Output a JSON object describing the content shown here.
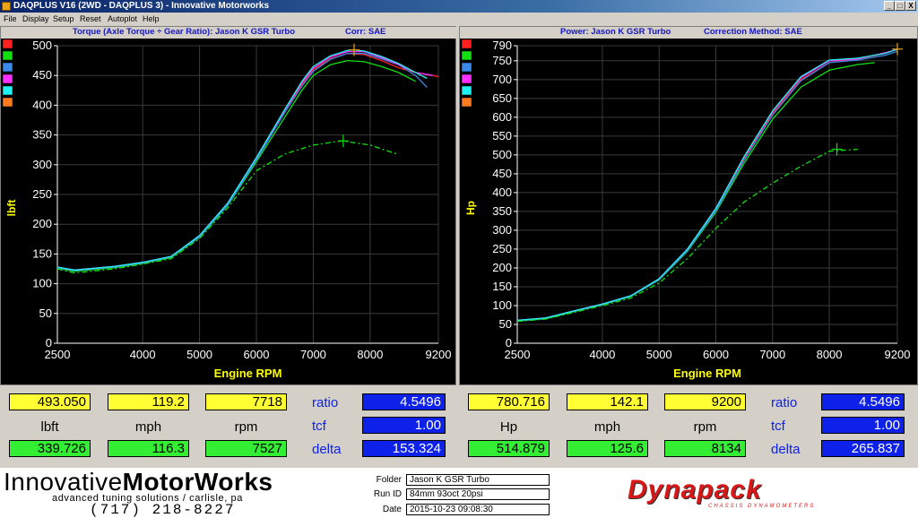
{
  "window": {
    "title": "DAQPLUS V16 (2WD - DAQPLUS 3) - Innovative Motorworks",
    "min": "_",
    "max": "□",
    "close": "X"
  },
  "menu": [
    "File",
    "Display",
    "Setup",
    "Reset",
    "Autoplot",
    "Help"
  ],
  "colors": {
    "series": [
      "#ff2020",
      "#10e010",
      "#3a88e8",
      "#ff30ff",
      "#20f0f0",
      "#ff7a20"
    ],
    "axis_text": "#ffffff",
    "axis_label": "#ffff00",
    "grid": "#3a3a3a"
  },
  "torque_panel": {
    "header_title": "Torque (Axle Torque ÷ Gear Ratio): Jason K GSR Turbo",
    "header_corr": "Corr: SAE",
    "ylabel": "lbft",
    "xlabel": "Engine RPM",
    "readout": {
      "peak_value": "493.050",
      "peak_mph": "119.2",
      "peak_rpm": "7718",
      "unit": "lbft",
      "mph_label": "mph",
      "rpm_label": "rpm",
      "base_value": "339.726",
      "base_mph": "116.3",
      "base_rpm": "7527",
      "ratio_label": "ratio",
      "ratio": "4.5496",
      "tcf_label": "tcf",
      "tcf": "1.00",
      "delta_label": "delta",
      "delta": "153.324"
    }
  },
  "power_panel": {
    "header_title": "Power: Jason K GSR Turbo",
    "header_corr": "Correction Method: SAE",
    "ylabel": "Hp",
    "xlabel": "Engine RPM",
    "readout": {
      "peak_value": "780.716",
      "peak_mph": "142.1",
      "peak_rpm": "9200",
      "unit": "Hp",
      "mph_label": "mph",
      "rpm_label": "rpm",
      "base_value": "514.879",
      "base_mph": "125.6",
      "base_rpm": "8134",
      "ratio_label": "ratio",
      "ratio": "4.5496",
      "tcf_label": "tcf",
      "tcf": "1.00",
      "delta_label": "delta",
      "delta": "265.837"
    }
  },
  "footer": {
    "logo_light": "Innovative",
    "logo_bold": "MotorWorks",
    "tagline": "advanced tuning solutions / carlisle, pa",
    "phone": "(717)  218-8227",
    "folder_label": "Folder",
    "folder": "Jason K GSR Turbo",
    "runid_label": "Run ID",
    "runid": "84mm 93oct 20psi",
    "date_label": "Date",
    "date": "2015-10-23 09:08:30",
    "brand": "Dynapack",
    "brand_sub": "CHASSIS DYNAMOMETERS"
  },
  "chart_data": [
    {
      "type": "line",
      "title": "Torque (Axle Torque ÷ Gear Ratio): Jason K GSR Turbo",
      "xlabel": "Engine RPM",
      "ylabel": "lbft",
      "xlim": [
        2500,
        9200
      ],
      "ylim": [
        0,
        500
      ],
      "xticks": [
        2500,
        4000,
        5000,
        6000,
        7000,
        8000,
        9200
      ],
      "yticks": [
        0,
        50,
        100,
        150,
        200,
        250,
        300,
        350,
        400,
        450,
        500
      ],
      "grid": true,
      "legend": "left",
      "series": [
        {
          "color": "#ff2020",
          "style": "solid",
          "x": [
            2500,
            2800,
            3500,
            4000,
            4500,
            5000,
            5500,
            6000,
            6500,
            6800,
            7000,
            7300,
            7600,
            7900,
            8200,
            8500,
            8800,
            9100,
            9200
          ],
          "y": [
            128,
            122,
            128,
            135,
            145,
            180,
            235,
            310,
            390,
            435,
            460,
            478,
            487,
            485,
            475,
            463,
            455,
            450,
            448
          ]
        },
        {
          "color": "#10e010",
          "style": "solid",
          "x": [
            2500,
            2800,
            3500,
            4000,
            4500,
            5000,
            5500,
            6000,
            6500,
            6800,
            7000,
            7300,
            7600,
            7900,
            8200,
            8500,
            8800
          ],
          "y": [
            126,
            121,
            127,
            134,
            144,
            178,
            232,
            305,
            380,
            425,
            450,
            468,
            475,
            473,
            465,
            455,
            440
          ]
        },
        {
          "color": "#3a88e8",
          "style": "solid",
          "x": [
            2500,
            2800,
            3500,
            4000,
            4500,
            5000,
            5500,
            6000,
            6500,
            6800,
            7000,
            7300,
            7600,
            7900,
            8200,
            8500,
            8800,
            9000
          ],
          "y": [
            127,
            122,
            128,
            135,
            145,
            179,
            233,
            308,
            388,
            432,
            457,
            477,
            487,
            487,
            478,
            468,
            450,
            430
          ]
        },
        {
          "color": "#ff30ff",
          "style": "solid",
          "x": [
            2500,
            2800,
            3500,
            4000,
            4500,
            5000,
            5500,
            6000,
            6500,
            6800,
            7000,
            7300,
            7600,
            7900,
            8200,
            8500,
            8800,
            9100
          ],
          "y": [
            128,
            123,
            129,
            136,
            146,
            181,
            236,
            312,
            392,
            438,
            462,
            481,
            490,
            490,
            480,
            468,
            455,
            450
          ]
        },
        {
          "color": "#20f0f0",
          "style": "solid",
          "x": [
            2500,
            2800,
            3500,
            4000,
            4500,
            5000,
            5500,
            6000,
            6500,
            6800,
            7000,
            7300,
            7600,
            7700,
            7900,
            8200,
            8500,
            8800,
            9000
          ],
          "y": [
            128,
            123,
            129,
            136,
            146,
            181,
            236,
            312,
            393,
            440,
            465,
            483,
            492,
            493,
            491,
            482,
            470,
            455,
            445
          ]
        },
        {
          "color": "#10e010",
          "style": "dashed",
          "x": [
            2500,
            2800,
            3500,
            4000,
            4500,
            5000,
            5500,
            6000,
            6500,
            7000,
            7500,
            8000,
            8500
          ],
          "y": [
            125,
            118,
            125,
            133,
            142,
            176,
            228,
            290,
            318,
            333,
            340,
            333,
            317
          ]
        }
      ],
      "markers": [
        {
          "x": 7718,
          "y": 493
        },
        {
          "x": 7527,
          "y": 340
        }
      ]
    },
    {
      "type": "line",
      "title": "Power: Jason K GSR Turbo",
      "xlabel": "Engine RPM",
      "ylabel": "Hp",
      "xlim": [
        2500,
        9200
      ],
      "ylim": [
        0,
        790
      ],
      "xticks": [
        2500,
        4000,
        5000,
        6000,
        7000,
        8000,
        9200
      ],
      "yticks": [
        0,
        50,
        100,
        150,
        200,
        250,
        300,
        350,
        400,
        450,
        500,
        550,
        600,
        650,
        700,
        750,
        790
      ],
      "grid": true,
      "legend": "left",
      "series": [
        {
          "color": "#ff2020",
          "style": "solid",
          "x": [
            2500,
            3000,
            3500,
            4000,
            4500,
            5000,
            5500,
            6000,
            6500,
            7000,
            7500,
            8000,
            8500,
            9000,
            9200
          ],
          "y": [
            60,
            66,
            85,
            103,
            125,
            170,
            248,
            355,
            490,
            610,
            700,
            745,
            755,
            770,
            781
          ]
        },
        {
          "color": "#10e010",
          "style": "solid",
          "x": [
            2500,
            3000,
            3500,
            4000,
            4500,
            5000,
            5500,
            6000,
            6500,
            7000,
            7500,
            8000,
            8500,
            8800
          ],
          "y": [
            59,
            65,
            84,
            102,
            124,
            168,
            244,
            348,
            478,
            595,
            680,
            725,
            740,
            745
          ]
        },
        {
          "color": "#3a88e8",
          "style": "solid",
          "x": [
            2500,
            3000,
            3500,
            4000,
            4500,
            5000,
            5500,
            6000,
            6500,
            7000,
            7500,
            8000,
            8500,
            9000,
            9200
          ],
          "y": [
            60,
            66,
            85,
            103,
            125,
            169,
            246,
            352,
            486,
            606,
            697,
            745,
            752,
            765,
            775
          ]
        },
        {
          "color": "#ff30ff",
          "style": "solid",
          "x": [
            2500,
            3000,
            3500,
            4000,
            4500,
            5000,
            5500,
            6000,
            6500,
            7000,
            7500,
            8000,
            8500,
            9000,
            9200
          ],
          "y": [
            61,
            67,
            86,
            104,
            126,
            171,
            250,
            358,
            495,
            615,
            705,
            750,
            755,
            772,
            780
          ]
        },
        {
          "color": "#20f0f0",
          "style": "solid",
          "x": [
            2500,
            3000,
            3500,
            4000,
            4500,
            5000,
            5500,
            6000,
            6500,
            7000,
            7500,
            8000,
            8500,
            9000,
            9200
          ],
          "y": [
            61,
            67,
            86,
            104,
            126,
            171,
            250,
            358,
            496,
            617,
            708,
            752,
            757,
            770,
            781
          ]
        },
        {
          "color": "#10e010",
          "style": "dashed",
          "x": [
            2500,
            3000,
            3500,
            4000,
            4500,
            5000,
            5500,
            6000,
            6500,
            7000,
            7500,
            8000,
            8500
          ],
          "y": [
            58,
            64,
            82,
            100,
            120,
            160,
            225,
            305,
            375,
            425,
            470,
            510,
            515
          ]
        }
      ],
      "markers": [
        {
          "x": 9200,
          "y": 781
        },
        {
          "x": 8134,
          "y": 515
        }
      ]
    }
  ]
}
